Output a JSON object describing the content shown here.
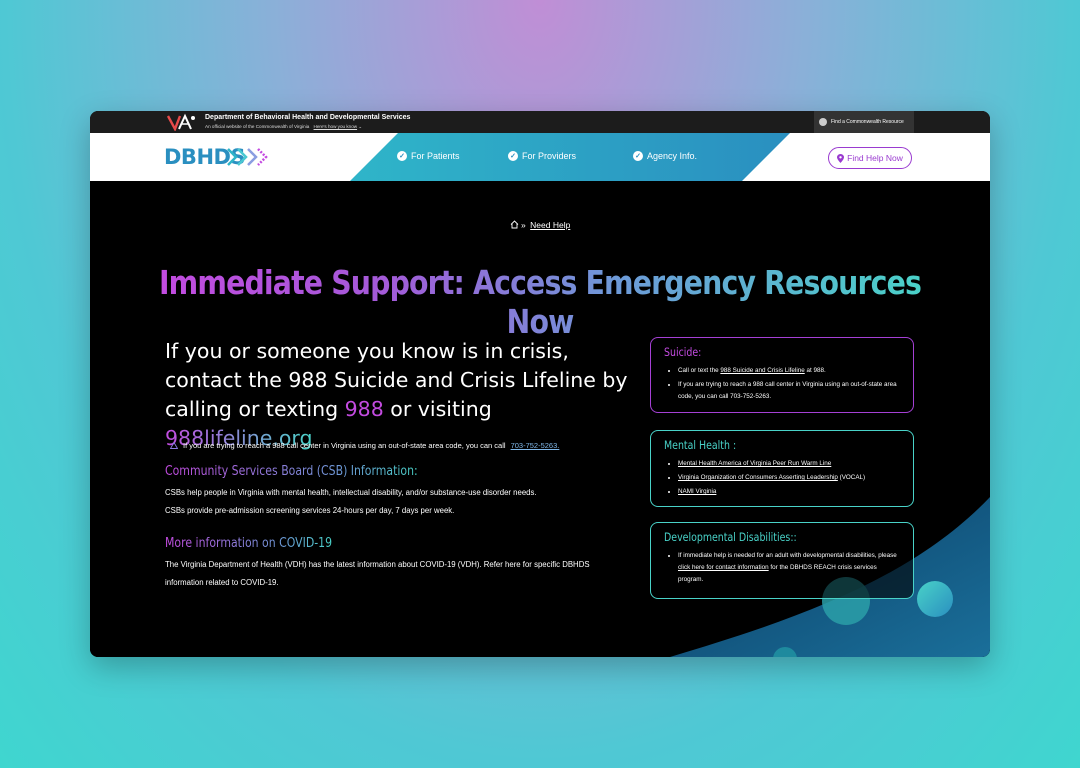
{
  "gov_bar": {
    "title": "Department of Behavioral Health and Developmental Services",
    "subtitle": "An official website of the Commonwealth of Virginia",
    "heres_how": "Here's how you know",
    "resource_button": "Find a Commonwealth Resource"
  },
  "nav": {
    "logo": "DBHDS",
    "items": [
      {
        "label": "For Patients"
      },
      {
        "label": "For Providers"
      },
      {
        "label": "Agency Info."
      }
    ],
    "find_help": "Find Help Now"
  },
  "breadcrumb": {
    "sep": "»",
    "current": "Need Help"
  },
  "headline": "Immediate Support: Access Emergency Resources Now",
  "crisis": {
    "line1": "If you or someone you know is in crisis, contact the 988 Suicide and Crisis Lifeline by calling or texting",
    "num": "988",
    "mid": "or visiting",
    "link": "988lifeline.org"
  },
  "warning": {
    "text": "If you are trying to reach a 988 call center in Virginia using an out-of-state area code, you can call",
    "phone": "703-752-5263."
  },
  "csb": {
    "title": "Community Services Board (CSB) Information:",
    "line1": "CSBs help people in Virginia with mental health, intellectual disability, and/or substance-use disorder needs.",
    "line2": "CSBs provide pre-admission screening services 24-hours per day, 7 days per week."
  },
  "covid": {
    "title": "More information on COVID-19",
    "line1": "The Virginia Department of Health (VDH) has the latest information about COVID-19 (VDH). Refer here for specific DBHDS",
    "line2": "information related to COVID-19."
  },
  "cards": {
    "suicide": {
      "title": "Suicide:",
      "b1a": "Call or text the",
      "b1link": "988 Suicide and Crisis Lifeline",
      "b1b": "at 988.",
      "b2": "If you are trying to reach a 988 call center in Virginia using an out-of-state area code, you can call 703-752-5263."
    },
    "mental": {
      "title": "Mental Health :",
      "l1": "Mental Health America of Virginia Peer Run Warm Line",
      "l2": "Virginia Organization of Consumers Asserting Leadership",
      "l2b": "(VOCAL)",
      "l3": "NAMI Virginia"
    },
    "dev": {
      "title": "Developmental Disabilities::",
      "a": "If immediate help is needed for an adult with developmental disabilities, please",
      "link": "click here for contact information",
      "b": "for the DBHDS REACH crisis services program."
    }
  },
  "colors": {
    "purple": "#c34be0",
    "teal": "#49d2c8",
    "blue": "#2a8fc0"
  }
}
